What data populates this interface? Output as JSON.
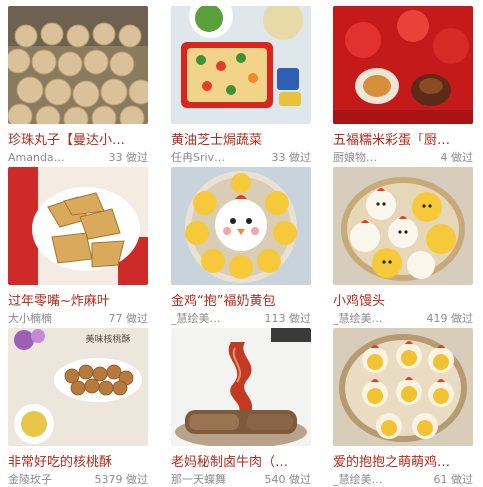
{
  "count_suffix": "做过",
  "recipes": [
    {
      "title": "珍珠丸子【曼达小…",
      "author": "Amanda…",
      "count": "33",
      "photo": "pearl-balls-photo"
    },
    {
      "title": "黄油芝士焗蔬菜",
      "author": "任冉Sriv…",
      "count": "33",
      "photo": "baked-vegetables-photo"
    },
    {
      "title": "五福糯米彩蛋「厨…",
      "author": "厨娘物…",
      "count": "4",
      "photo": "glutinous-rice-egg-photo"
    },
    {
      "title": "过年零嘴~炸麻叶",
      "author": "大小楠楠",
      "count": "77",
      "photo": "fried-snack-photo"
    },
    {
      "title": "金鸡“抱”福奶黄包",
      "author": "_慧绘美…",
      "count": "113",
      "photo": "chick-custard-bun-photo"
    },
    {
      "title": "小鸡馒头",
      "author": "_慧绘美…",
      "count": "419",
      "photo": "chick-steamed-bun-photo"
    },
    {
      "title": "非常好吃的核桃酥",
      "author": "金陵玫子",
      "count": "5379",
      "photo": "walnut-cookie-photo"
    },
    {
      "title": "老妈秘制卤牛肉（…",
      "author": "那一天蝶舞",
      "count": "540",
      "photo": "braised-beef-photo"
    },
    {
      "title": "爱的抱抱之萌萌鸡…",
      "author": "_慧绘美…",
      "count": "61",
      "photo": "hug-chick-bun-photo"
    }
  ],
  "plate_text": "美味核桃酥",
  "colors": {
    "title": "#b22a1c",
    "meta": "#8c8c8c"
  }
}
